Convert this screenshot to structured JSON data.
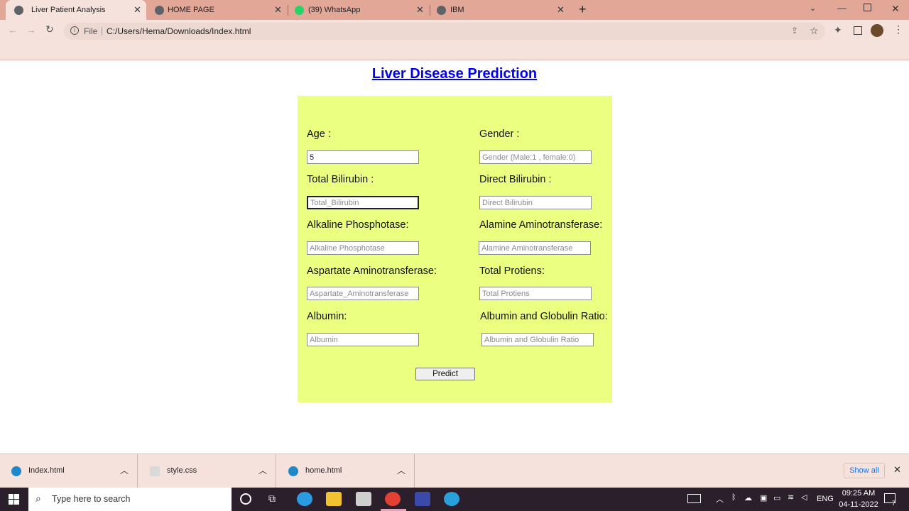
{
  "browser": {
    "tabs": [
      {
        "label": "Liver Patient Analysis",
        "active": true
      },
      {
        "label": "HOME PAGE",
        "active": false
      },
      {
        "label": "(39) WhatsApp",
        "active": false
      },
      {
        "label": "IBM",
        "active": false
      }
    ],
    "url_scheme": "File",
    "url": "C:/Users/Hema/Downloads/Index.html"
  },
  "page": {
    "title": "Liver Disease Prediction",
    "fields": [
      {
        "label": "Age :",
        "placeholder": "",
        "value": "5"
      },
      {
        "label": "Gender :",
        "placeholder": "Gender (Male:1 , female:0)",
        "value": ""
      },
      {
        "label": "Total Bilirubin :",
        "placeholder": "Total_Bilirubin",
        "value": ""
      },
      {
        "label": "Direct Bilirubin :",
        "placeholder": "Direct Bilirubin",
        "value": ""
      },
      {
        "label": "Alkaline Phosphotase:",
        "placeholder": "Alkaline Phosphotase",
        "value": ""
      },
      {
        "label": "Alamine Aminotransferase:",
        "placeholder": "Alamine Aminotransferase",
        "value": ""
      },
      {
        "label": "Aspartate Aminotransferase:",
        "placeholder": "Aspartate_Aminotransferase",
        "value": ""
      },
      {
        "label": "Total Protiens:",
        "placeholder": "Total Protiens",
        "value": ""
      },
      {
        "label": "Albumin:",
        "placeholder": "Albumin",
        "value": ""
      },
      {
        "label": "Albumin and Globulin Ratio:",
        "placeholder": "Albumin and Globulin Ratio",
        "value": ""
      }
    ],
    "predict_label": "Predict",
    "form_bg": "#ebff80",
    "title_color": "#0000ee"
  },
  "downloads": {
    "items": [
      {
        "name": "Index.html",
        "icon": "edge-icon"
      },
      {
        "name": "style.css",
        "icon": "file-icon"
      },
      {
        "name": "home.html",
        "icon": "edge-icon"
      }
    ],
    "show_all": "Show all"
  },
  "taskbar": {
    "search_placeholder": "Type here to search",
    "language": "ENG",
    "time": "09:25 AM",
    "date": "04-11-2022",
    "notification_count": "7"
  },
  "colors": {
    "tab_strip": "#e2a797",
    "toolbar": "#f6e2dd",
    "taskbar": "#2a1f2a"
  }
}
